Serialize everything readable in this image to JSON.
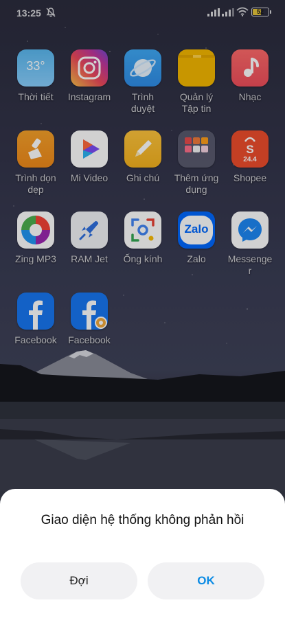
{
  "status_bar": {
    "time": "13:25",
    "battery": "52",
    "mute_icon": "bell-off-icon",
    "signal_icon": "signal-bars-icon",
    "wifi_icon": "wifi-icon"
  },
  "apps": [
    {
      "label": "Thời tiết",
      "icon": "weather-icon",
      "badge_text": "33°"
    },
    {
      "label": "Instagram",
      "icon": "instagram-icon"
    },
    {
      "label": "Trình\nduyệt",
      "icon": "browser-icon"
    },
    {
      "label": "Quản lý\nTập tin",
      "icon": "file-manager-icon"
    },
    {
      "label": "Nhạc",
      "icon": "music-icon"
    },
    {
      "label": "Trình dọn\ndẹp",
      "icon": "cleaner-icon"
    },
    {
      "label": "Mi Video",
      "icon": "mi-video-icon"
    },
    {
      "label": "Ghi chú",
      "icon": "notes-icon"
    },
    {
      "label": "Thêm ứng\ndụng",
      "icon": "folder-icon"
    },
    {
      "label": "Shopee",
      "icon": "shopee-icon",
      "badge_text": "24.4"
    },
    {
      "label": "Zing MP3",
      "icon": "zing-mp3-icon"
    },
    {
      "label": "RAM Jet",
      "icon": "ram-jet-icon"
    },
    {
      "label": "Ống kính",
      "icon": "lens-icon"
    },
    {
      "label": "Zalo",
      "icon": "zalo-icon",
      "badge_text": "Zalo"
    },
    {
      "label": "Messenge\nr",
      "icon": "messenger-icon"
    },
    {
      "label": "Facebook",
      "icon": "facebook-icon"
    },
    {
      "label": "Facebook",
      "icon": "facebook-clone-icon"
    }
  ],
  "dialog": {
    "title": "Giao diện hệ thống không phản hồi",
    "wait_label": "Đợi",
    "ok_label": "OK"
  },
  "colors": {
    "accent": "#0b8be4",
    "dialog_bg": "#ffffff",
    "button_bg": "#f1f1f3"
  }
}
